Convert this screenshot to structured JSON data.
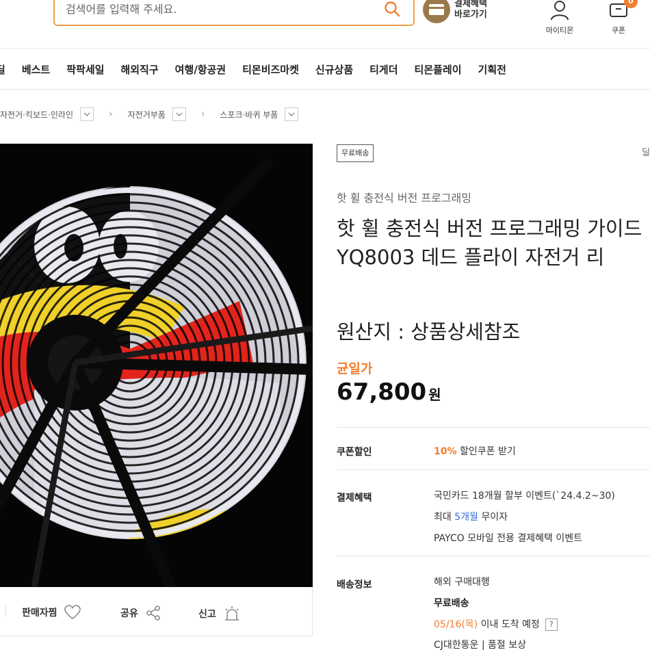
{
  "header": {
    "search": {
      "placeholder": "검색어를 입력해 주세요."
    },
    "pay_benefit": {
      "line1": "결제혜택",
      "line2": "바로가기"
    },
    "my_tmon": "마이티몬",
    "coupon": "쿠폰",
    "coupon_count": "0"
  },
  "nav": {
    "items": [
      "딜",
      "베스트",
      "팍팍세일",
      "해외직구",
      "여행/항공권",
      "티몬비즈마켓",
      "신규상품",
      "티게더",
      "티몬플레이",
      "기획전"
    ]
  },
  "breadcrumb": [
    "자전거·킥보드·인라인",
    "자전거부품",
    "스포크·바퀴 부품"
  ],
  "image_actions": {
    "wish": "판매자찜",
    "share": "공유",
    "report": "신고"
  },
  "product": {
    "tag": "무료배송",
    "right_cut": "딜",
    "brand": "핫 휠 충전식 버전 프로그래밍",
    "title": "핫 휠 충전식 버전 프로그래밍 가이드 YQ8003 데드 플라이 자전거 리",
    "origin": "원산지 : 상품상세참조",
    "price_label": "균일가",
    "price": "67,800",
    "currency": "원"
  },
  "info": {
    "coupon": {
      "label": "쿠폰할인",
      "percent": "10%",
      "text": "할인쿠폰 받기"
    },
    "payment": {
      "label": "결제혜택",
      "line1": "국민카드 18개월 할부 이벤트(`24.4.2~30)",
      "line2_prefix": "최대 ",
      "line2_highlight": "5개월",
      "line2_suffix": " 무이자",
      "line3": "PAYCO 모바일 전용 결제혜택 이벤트"
    },
    "delivery": {
      "label": "배송정보",
      "line1": "해외 구매대행",
      "line2": "무료배송",
      "date": "05/16(목)",
      "date_suffix": " 이내 도착 예정",
      "help": "?",
      "line4": "CJ대한통운 | 품절 보상"
    }
  },
  "colors": {
    "accent": "#f27d2e",
    "search_border": "#f0a04b",
    "link_blue": "#3a6fd8"
  }
}
